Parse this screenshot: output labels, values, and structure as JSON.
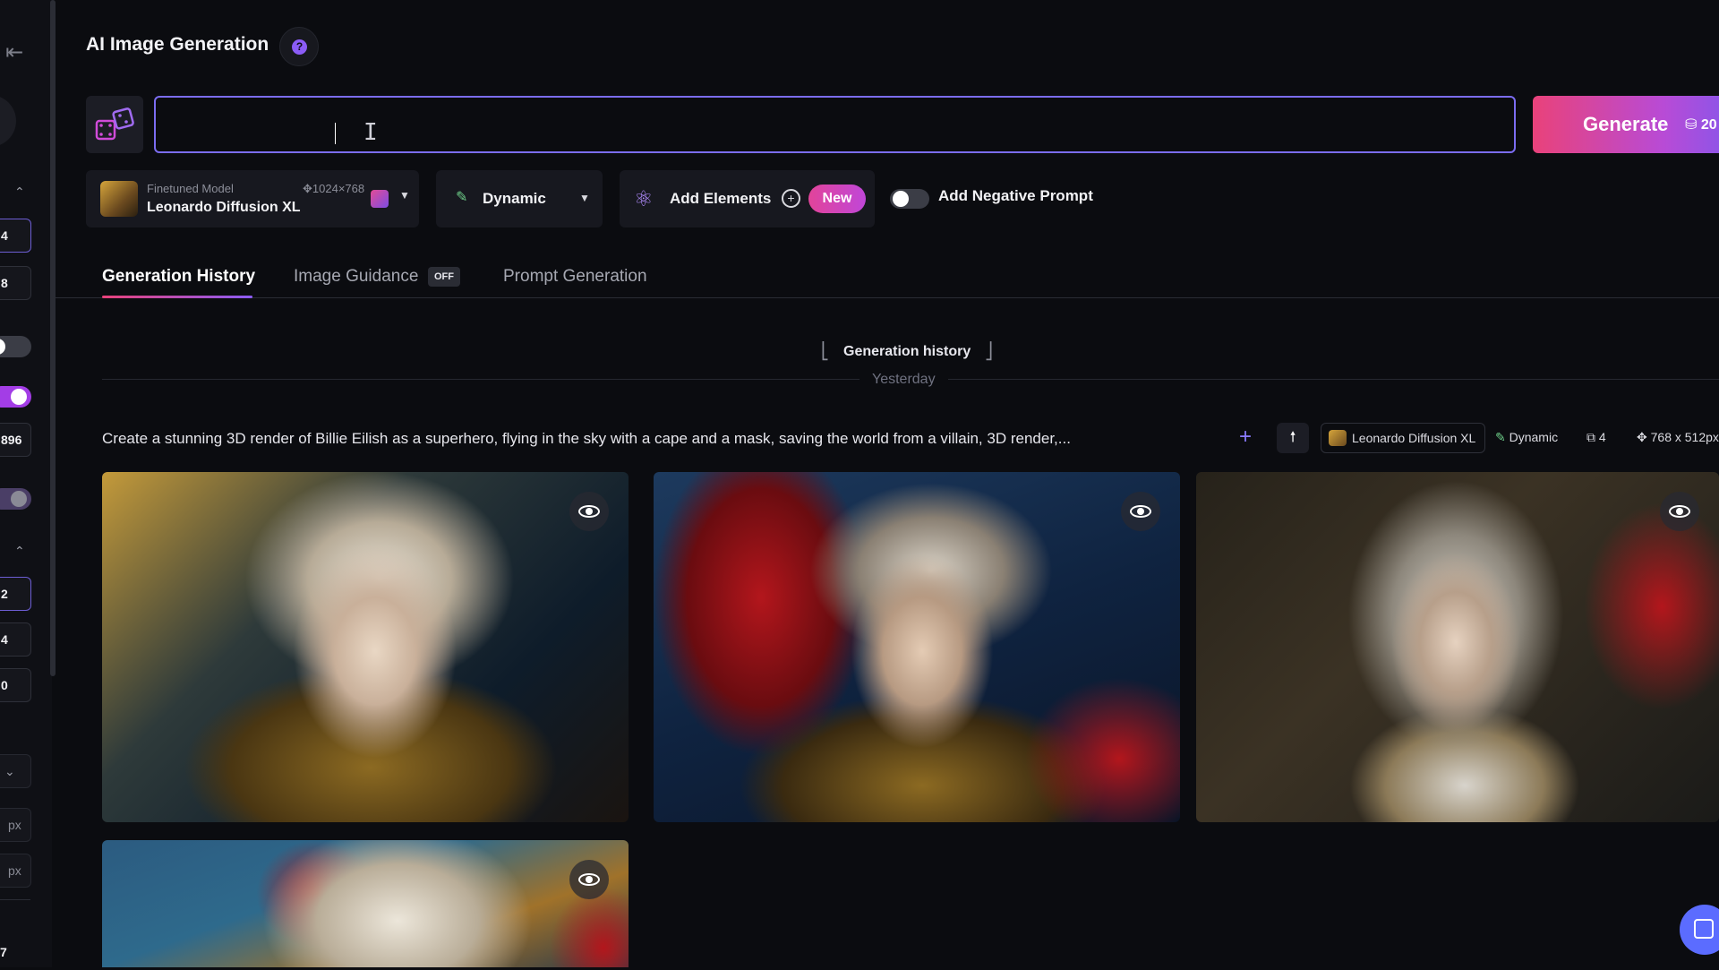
{
  "sidebar": {
    "collapse_icon": "arrow-left-bar-icon",
    "values": [
      "4",
      "8",
      "896",
      "2",
      "4",
      "0",
      "7"
    ],
    "units": [
      "px",
      "px"
    ]
  },
  "header": {
    "title": "AI Image Generation",
    "help": "?"
  },
  "prompt": {
    "value": "",
    "generate_label": "Generate",
    "token_cost": "20"
  },
  "model": {
    "subtitle": "Finetuned Model",
    "resolution": "1024×768",
    "name": "Leonardo Diffusion XL"
  },
  "style": {
    "name": "Dynamic"
  },
  "elements": {
    "label": "Add Elements",
    "badge": "New"
  },
  "negative_prompt": {
    "label": "Add Negative Prompt",
    "enabled": false
  },
  "tabs": [
    {
      "label": "Generation History",
      "active": true
    },
    {
      "label": "Image Guidance",
      "badge": "OFF"
    },
    {
      "label": "Prompt Generation"
    }
  ],
  "history": {
    "title": "Generation history",
    "day": "Yesterday",
    "generation": {
      "prompt": "Create a stunning 3D render of Billie Eilish as a superhero, flying in the sky with a cape and a mask, saving the world from a villain, 3D render,...",
      "model": "Leonardo Diffusion XL",
      "style": "Dynamic",
      "count": "4",
      "resolution": "768 x 512px"
    }
  },
  "colors": {
    "accent": "#7b6cf0",
    "generate_from": "#e9427a",
    "generate_to": "#6d5cf5",
    "background": "#0b0c10"
  }
}
